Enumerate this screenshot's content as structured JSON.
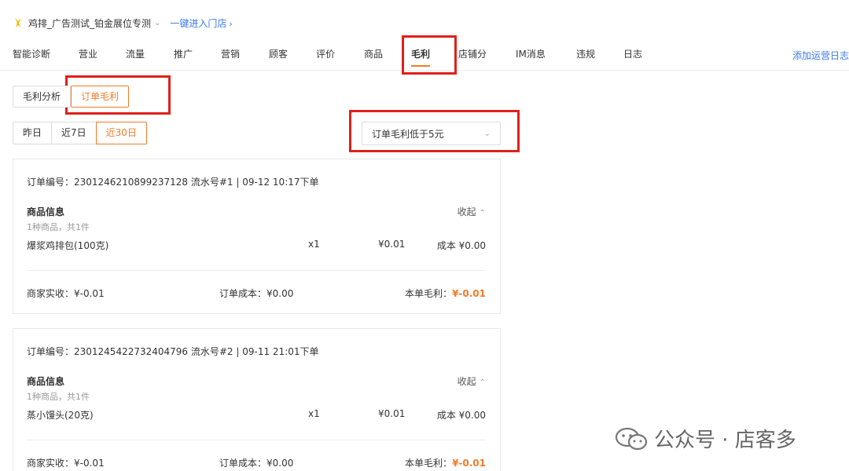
{
  "store": {
    "name": "鸡排_广告测试_铂金展位专测",
    "enter_link": "一键进入门店"
  },
  "nav": {
    "tabs": [
      "智能诊断",
      "营业",
      "流量",
      "推广",
      "营销",
      "顾客",
      "评价",
      "商品",
      "毛利",
      "店铺分",
      "IM消息",
      "违规",
      "日志"
    ],
    "active": "毛利",
    "right_link": "添加运营日志"
  },
  "subtabs": [
    "毛利分析",
    "订单毛利"
  ],
  "subtab_active": "订单毛利",
  "ranges": [
    "昨日",
    "近7日",
    "近30日"
  ],
  "range_active": "近30日",
  "filter": {
    "selected": "订单毛利低于5元"
  },
  "labels": {
    "goods_info": "商品信息",
    "collapse": "收起",
    "received": "商家实收：",
    "order_cost": "订单成本：",
    "order_profit": "本单毛利："
  },
  "orders": [
    {
      "header": "订单编号：2301246210899237128 流水号#1 | 09-12 10:17下单",
      "summary": "1种商品，共1件",
      "item": {
        "name": "爆浆鸡排包(100克)",
        "qty": "x1",
        "price": "¥0.01",
        "cost": "成本 ¥0.00"
      },
      "received": "¥-0.01",
      "cost": "¥0.00",
      "profit": "¥-0.01"
    },
    {
      "header": "订单编号：2301245422732404796 流水号#2 | 09-11 21:01下单",
      "summary": "1种商品，共1件",
      "item": {
        "name": "蒸小馒头(20克)",
        "qty": "x1",
        "price": "¥0.01",
        "cost": "成本 ¥0.00"
      },
      "received": "¥-0.01",
      "cost": "¥0.00",
      "profit": "¥-0.01"
    }
  ],
  "watermark": {
    "text": "公众号 · 店客多"
  },
  "colors": {
    "accent": "#f07b2a",
    "link": "#3b78e7",
    "annotation": "#e0201b"
  }
}
